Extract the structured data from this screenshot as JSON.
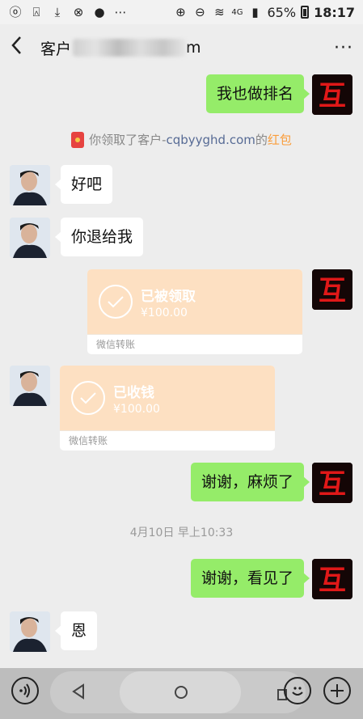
{
  "status_bar": {
    "battery": "65%",
    "time": "18:17",
    "network": "4G"
  },
  "header": {
    "title_prefix": "客户",
    "title_visible_suffix": "m",
    "more_label": "···",
    "back_icon": "chevron-left-icon"
  },
  "messages": [
    {
      "side": "right",
      "type": "text",
      "text": "我也做排名"
    },
    {
      "side": "left",
      "type": "text",
      "text": "好吧"
    },
    {
      "side": "left",
      "type": "text",
      "text": "你退给我"
    },
    {
      "side": "right",
      "type": "transfer",
      "status": "已被领取",
      "amount": "¥100.00",
      "footer": "微信转账"
    },
    {
      "side": "left",
      "type": "transfer",
      "status": "已收钱",
      "amount": "¥100.00",
      "footer": "微信转账"
    },
    {
      "side": "right",
      "type": "text",
      "text": "谢谢，麻烦了"
    },
    {
      "side": "right",
      "type": "text",
      "text": "谢谢，看见了"
    },
    {
      "side": "left",
      "type": "text",
      "text": "恩"
    }
  ],
  "notice": {
    "prefix": "你领取了客户-",
    "link": "cqbyyghd.com",
    "middle": " 的",
    "highlight": "红包"
  },
  "timestamp": "4月10日 早上10:33",
  "self_avatar_char": "互",
  "colors": {
    "bubble_self": "#95ec69",
    "bubble_other": "#ffffff",
    "transfer": "#fde0c2",
    "background": "#ededed"
  }
}
